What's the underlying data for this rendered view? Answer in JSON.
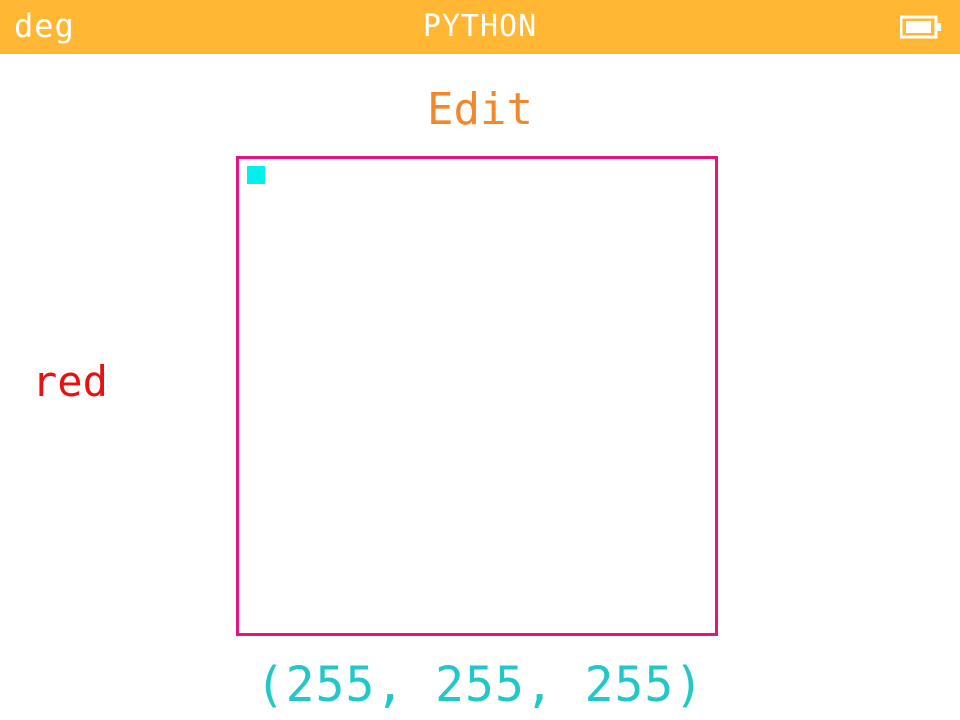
{
  "statusbar": {
    "angle_mode": "deg",
    "app_title": "PYTHON",
    "battery_icon": "battery-full-icon"
  },
  "title": "Edit",
  "left_label": "red",
  "canvas": {
    "cursor_color": "#00F0F0",
    "border_color": "#E5137C"
  },
  "rgb_readout": "(255, 255, 255)",
  "colors": {
    "statusbar_bg": "#FFB734",
    "title": "#F0882C",
    "label": "#E81010",
    "readout": "#22C7C7"
  }
}
